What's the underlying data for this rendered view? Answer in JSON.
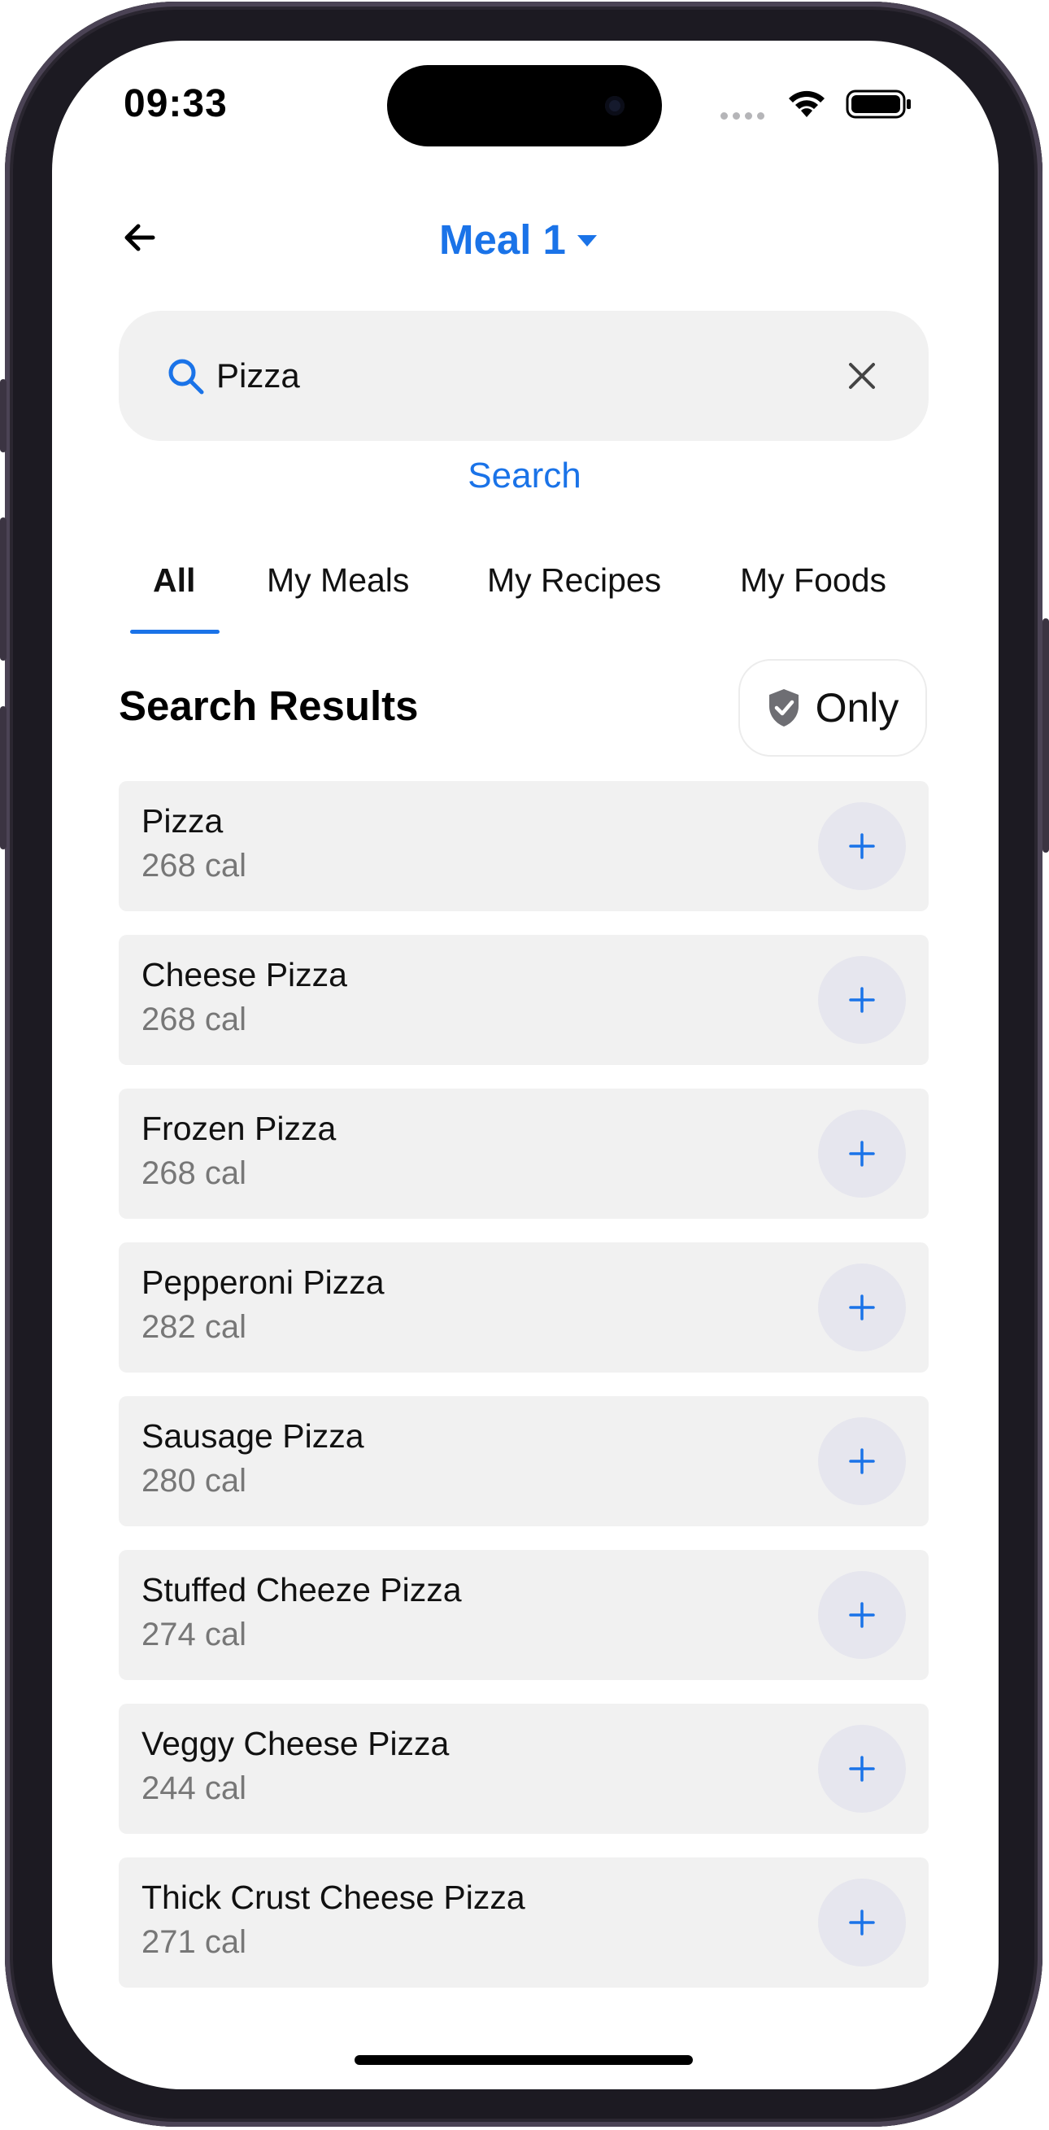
{
  "status_bar": {
    "time": "09:33"
  },
  "header": {
    "title": "Meal 1"
  },
  "search": {
    "value": "Pizza",
    "action_label": "Search"
  },
  "tabs": [
    {
      "label": "All",
      "active": true
    },
    {
      "label": "My Meals",
      "active": false
    },
    {
      "label": "My Recipes",
      "active": false
    },
    {
      "label": "My Foods",
      "active": false
    }
  ],
  "results": {
    "title": "Search Results",
    "filter_label": "Only",
    "items": [
      {
        "name": "Pizza",
        "calories": "268 cal"
      },
      {
        "name": "Cheese Pizza",
        "calories": "268 cal"
      },
      {
        "name": "Frozen Pizza",
        "calories": "268 cal"
      },
      {
        "name": "Pepperoni Pizza",
        "calories": "282 cal"
      },
      {
        "name": "Sausage Pizza",
        "calories": "280 cal"
      },
      {
        "name": "Stuffed Cheeze Pizza",
        "calories": "274 cal"
      },
      {
        "name": "Veggy Cheese Pizza",
        "calories": "244 cal"
      },
      {
        "name": "Thick Crust Cheese Pizza",
        "calories": "271 cal"
      }
    ]
  },
  "colors": {
    "accent": "#1a73e8",
    "row_bg": "#f1f1f1",
    "muted_text": "#777777"
  },
  "icons": [
    "back-arrow-icon",
    "dropdown-caret-icon",
    "search-icon",
    "clear-icon",
    "shield-check-icon",
    "plus-icon",
    "wifi-icon",
    "battery-icon"
  ]
}
